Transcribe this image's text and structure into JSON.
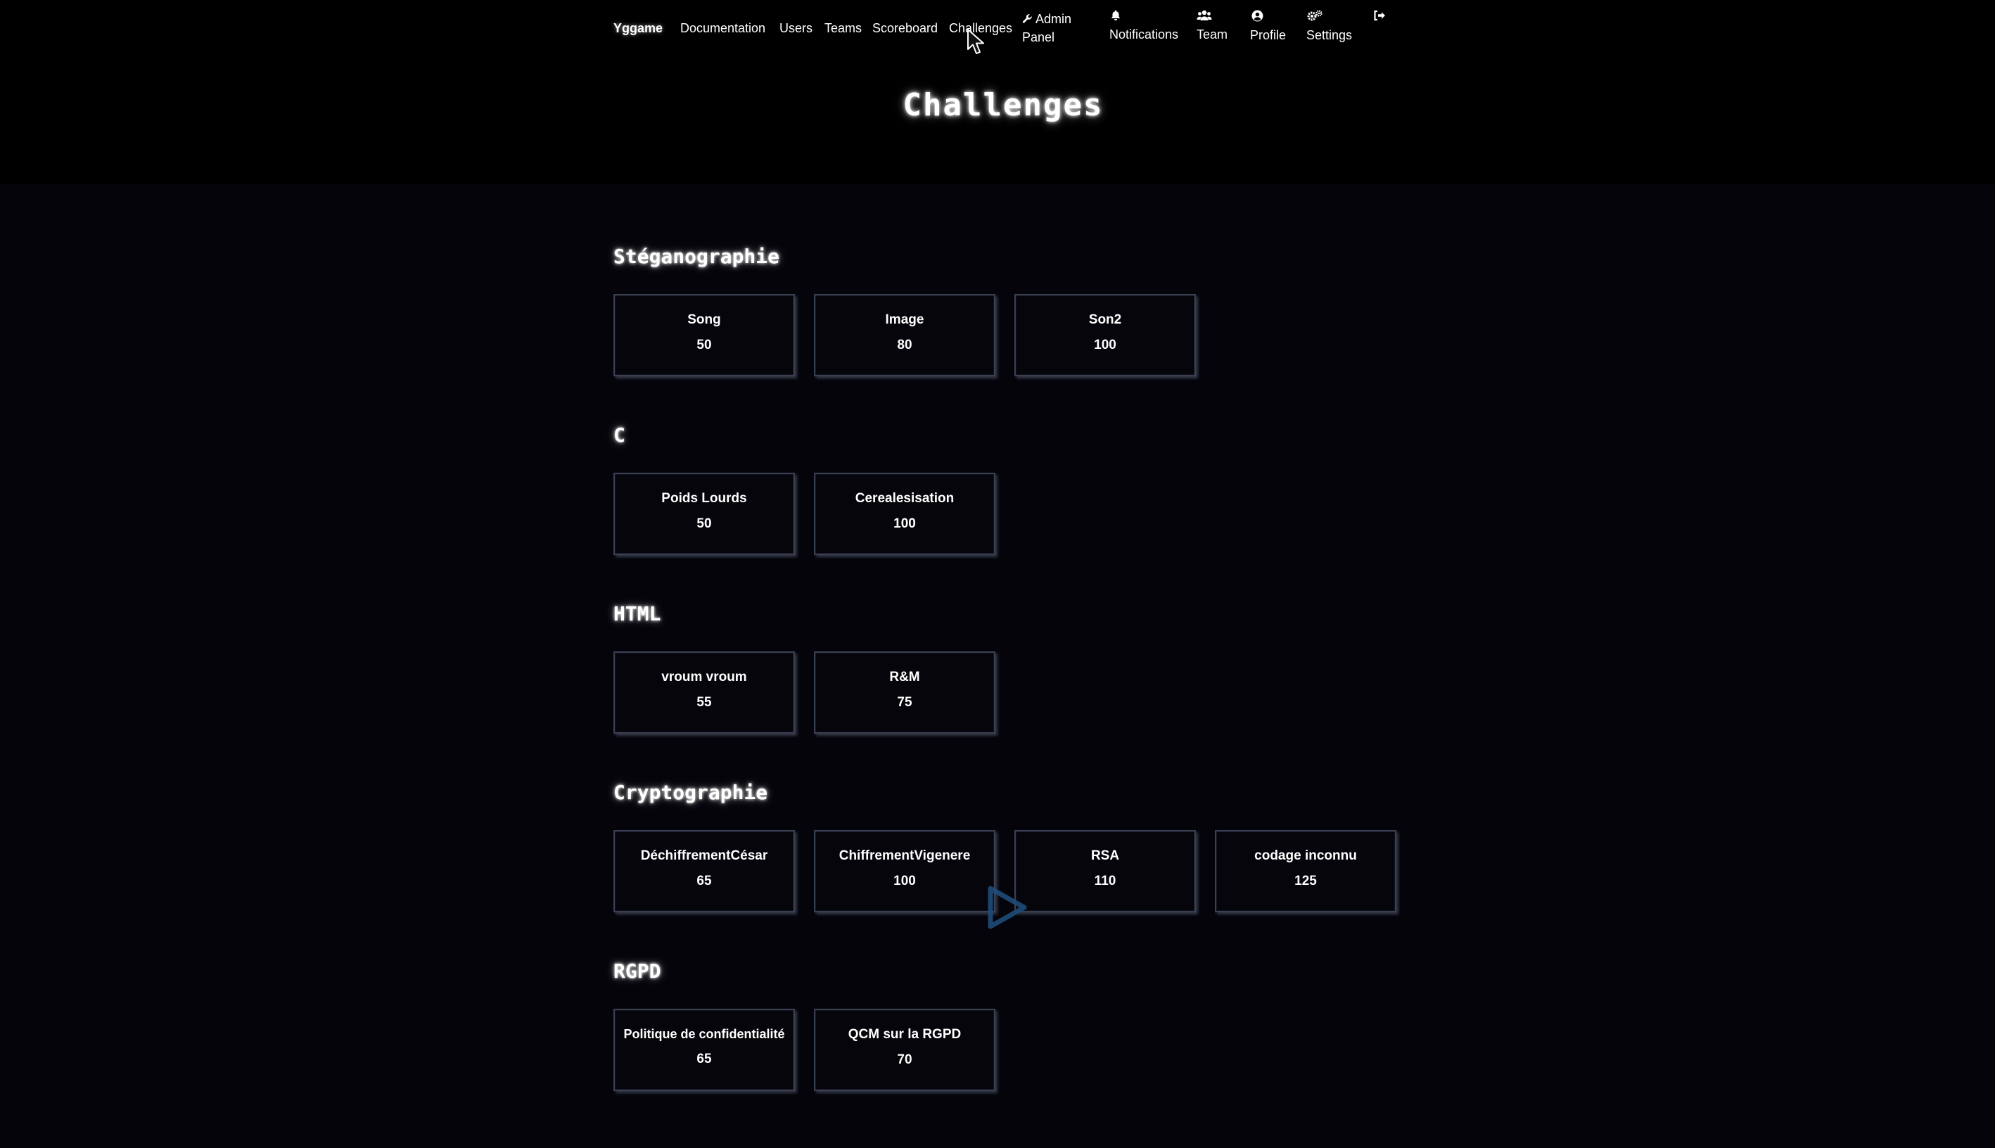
{
  "navbar": {
    "brand": "Yggame",
    "links": [
      "Documentation",
      "Users",
      "Teams",
      "Scoreboard",
      "Challenges"
    ],
    "admin_panel": "Admin Panel",
    "admin_line1": "Admin",
    "admin_line2": "Panel",
    "notifications": "Notifications",
    "team": "Team",
    "profile": "Profile",
    "settings": "Settings",
    "icons": {
      "admin": "wrench-icon",
      "notifications": "bell-icon",
      "team": "users-icon",
      "profile": "user-circle-icon",
      "settings": "cogs-icon",
      "logout": "logout-icon"
    }
  },
  "page_title": "Challenges",
  "categories": [
    {
      "name": "Stéganographie",
      "challenges": [
        {
          "name": "Song",
          "value": "50"
        },
        {
          "name": "Image",
          "value": "80"
        },
        {
          "name": "Son2",
          "value": "100"
        }
      ]
    },
    {
      "name": "C",
      "challenges": [
        {
          "name": "Poids Lourds",
          "value": "50"
        },
        {
          "name": "Cerealesisation",
          "value": "100"
        }
      ]
    },
    {
      "name": "HTML",
      "challenges": [
        {
          "name": "vroum vroum",
          "value": "55"
        },
        {
          "name": "R&M",
          "value": "75"
        }
      ]
    },
    {
      "name": "Cryptographie",
      "challenges": [
        {
          "name": "DéchiffrementCésar",
          "value": "65"
        },
        {
          "name": "ChiffrementVigenere",
          "value": "100"
        },
        {
          "name": "RSA",
          "value": "110"
        },
        {
          "name": "codage inconnu",
          "value": "125"
        }
      ]
    },
    {
      "name": "RGPD",
      "challenges": [
        {
          "name": "Politique de confidentialité",
          "value": "65"
        },
        {
          "name": "QCM sur la RGPD",
          "value": "70"
        }
      ]
    }
  ],
  "colors": {
    "background": "#030306",
    "card_border": "#3a3f52",
    "play_overlay": "#1f4d78"
  },
  "overlay_icon": "play-icon"
}
